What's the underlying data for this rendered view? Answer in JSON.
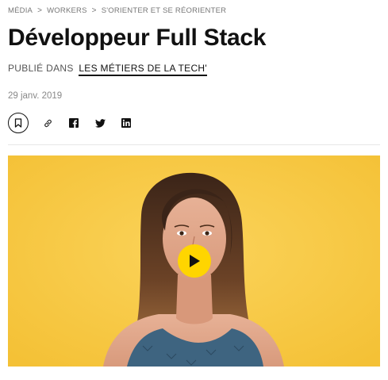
{
  "breadcrumb": {
    "items": [
      "MÉDIA",
      "WORKERS",
      "S'ORIENTER ET SE RÉORIENTER"
    ],
    "separator": ">"
  },
  "article": {
    "title": "Développeur Full Stack",
    "published_prefix": "PUBLIÉ DANS",
    "category": "LES MÉTIERS DE LA TECH'",
    "date": "29 janv. 2019"
  },
  "share": {
    "icons": [
      "bookmark-icon",
      "link-icon",
      "facebook-icon",
      "twitter-icon",
      "linkedin-icon"
    ]
  },
  "video": {
    "background_color": "#f6c84a",
    "play_button_color": "#ffd500"
  }
}
